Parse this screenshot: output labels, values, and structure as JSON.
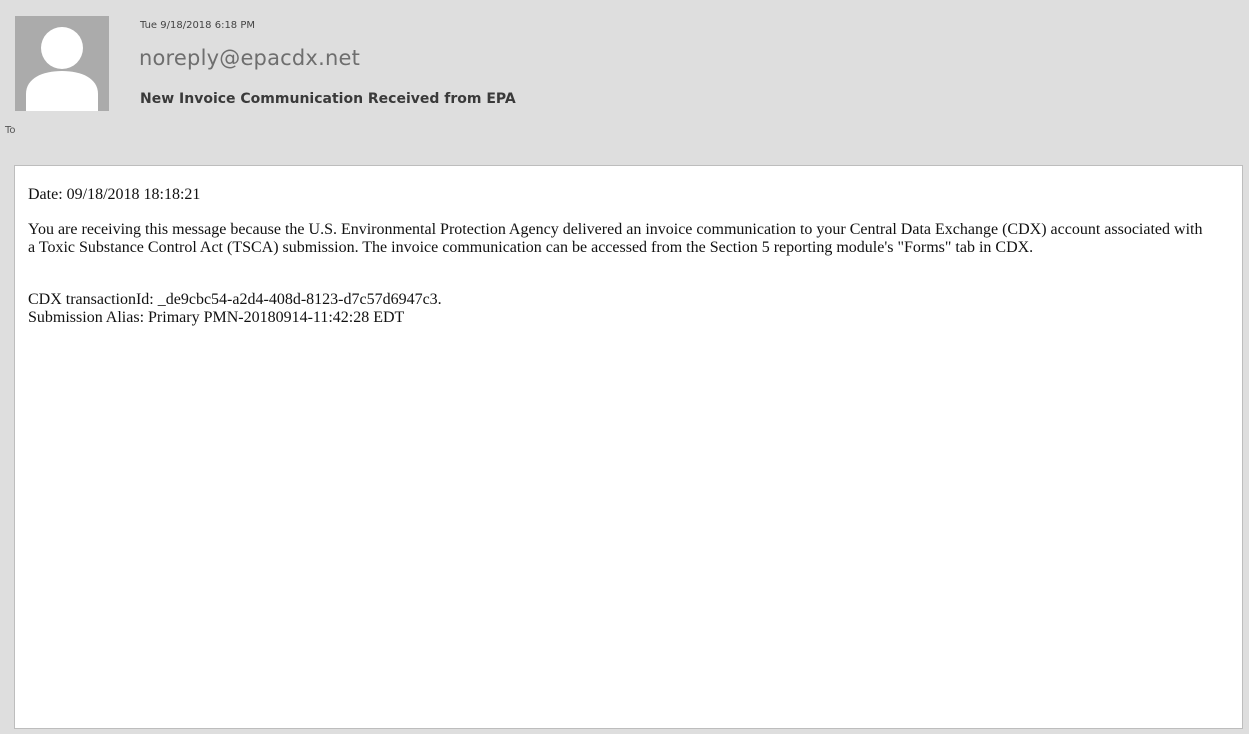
{
  "header": {
    "timestamp": "Tue 9/18/2018 6:18 PM",
    "sender": "noreply@epacdx.net",
    "subject": "New Invoice Communication Received from EPA",
    "to_label": "To",
    "avatar_icon": "person-icon"
  },
  "body": {
    "date_line": "Date: 09/18/2018 18:18:21",
    "message": "You are receiving this message because the U.S. Environmental Protection Agency delivered an invoice communication to your Central Data Exchange (CDX) account associated with a Toxic Substance Control Act (TSCA) submission. The invoice communication can be accessed from the Section 5 reporting module's \"Forms\" tab in CDX.",
    "transaction_line": "CDX transactionId: _de9cbc54-a2d4-408d-8123-d7c57d6947c3.",
    "alias_line": "Submission Alias: Primary PMN-20180914-11:42:28 EDT"
  },
  "colors": {
    "header_bg": "#dedede",
    "avatar_bg": "#ababab",
    "body_bg": "#ffffff"
  }
}
